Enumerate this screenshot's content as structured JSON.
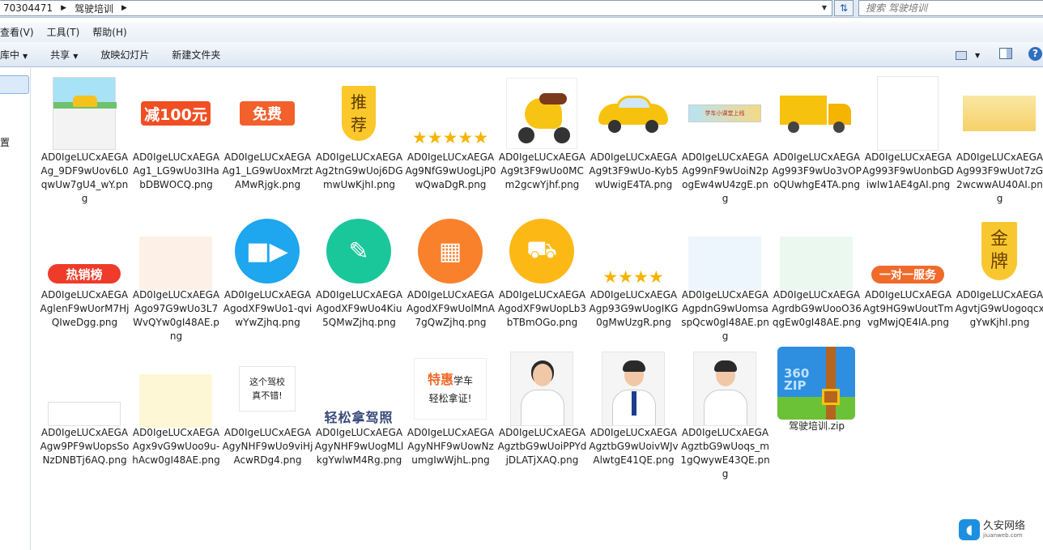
{
  "address": {
    "crumbs": [
      "70304471",
      "驾驶培训"
    ],
    "search_placeholder": "搜索 驾驶培训"
  },
  "menu": [
    "查看(V)",
    "工具(T)",
    "帮助(H)"
  ],
  "toolbar": {
    "items": [
      "库中",
      "共享",
      "放映幻灯片",
      "新建文件夹"
    ]
  },
  "nav": {
    "partial_label": "置"
  },
  "files": [
    "AD0IgeLUCxAEGAAg_9DF9wUov6L0qwUw7gU4_wY.png",
    "AD0IgeLUCxAEGAAg1_LG9wUo3IHabDBWOCQ.png",
    "AD0IgeLUCxAEGAAg1_LG9wUoxMrztAMwRjgk.png",
    "AD0IgeLUCxAEGAAg2tnG9wUoj6DGmwUwKjhI.png",
    "AD0IgeLUCxAEGAAg9NfG9wUogLjP0wQwaDgR.png",
    "AD0IgeLUCxAEGAAg9t3F9wUo0MCm2gcwYjhf.png",
    "AD0IgeLUCxAEGAAg9t3F9wUo-Kyb5wUwigE4TA.png",
    "AD0IgeLUCxAEGAAg99nF9wUoiN2pogEw4wU4zgE.png",
    "AD0IgeLUCxAEGAAg993F9wUo3vOPoQUwhgE4TA.png",
    "AD0IgeLUCxAEGAAg993F9wUonbGDiwIw1AE4gAI.png",
    "AD0IgeLUCxAEGAAg993F9wUot7zG2wcwwAU40AI.png",
    "AD0IgeLUCxAEGAAglenF9wUorM7HjQIweDgg.png",
    "AD0IgeLUCxAEGAAgo97G9wUo3L7WvQYw0gI48AE.png",
    "AD0IgeLUCxAEGAAgodXF9wUo1-qviwYwZjhq.png",
    "AD0IgeLUCxAEGAAgodXF9wUo4Kiu5QMwZjhq.png",
    "AD0IgeLUCxAEGAAgodXF9wUolMnA7gQwZjhq.png",
    "AD0IgeLUCxAEGAAgodXF9wUopLb3bTBmOGo.png",
    "AD0IgeLUCxAEGAAgp93G9wUogIKG0gMwUzgR.png",
    "AD0IgeLUCxAEGAAgpdnG9wUomsaspQcw0gI48AE.png",
    "AD0IgeLUCxAEGAAgrdbG9wUooO36qgEw0gI48AE.png",
    "AD0IgeLUCxAEGAAgt9HG9wUoutTmvgMwjQE4IA.png",
    "AD0IgeLUCxAEGAAgvtjG9wUogoqcxgYwKjhI.png",
    "AD0IgeLUCxAEGAAgw9PF9wUopsSoNzDNBTj6AQ.png",
    "AD0IgeLUCxAEGAAgx9vG9wUoo9u-hAcw0gI48AE.png",
    "AD0IgeLUCxAEGAAgyNHF9wUo9viHjAcwRDg4.png",
    "AD0IgeLUCxAEGAAgyNHF9wUogMLlkgYwlwM4Rg.png",
    "AD0IgeLUCxAEGAAgyNHF9wUowNzumgIwWjhL.png",
    "AD0IgeLUCxAEGAAgztbG9wUoiPPYdjDLATjXAQ.png",
    "AD0IgeLUCxAEGAAgztbG9wUoivWJvAlwtgE41QE.png",
    "AD0IgeLUCxAEGAAgztbG9wUoqs_m1gQwywE43QE.png",
    "驾驶培训.zip"
  ],
  "thumb_text": {
    "discount": "减100元",
    "free": "免费",
    "recommend_1": "推",
    "recommend_2": "荐",
    "hot": "热销榜",
    "one_service": "一对一服务",
    "gold_1": "金",
    "gold_2": "牌",
    "note_1": "这个驾校",
    "note_2": "真不错!",
    "easy": "轻松拿驾照",
    "tehui_1": "特惠",
    "tehui_2": "学车",
    "tehui_3": "轻松拿证!",
    "zip_label_1": "360",
    "zip_label_2": "ZIP",
    "strip": "学车小课堂上线"
  },
  "watermark": {
    "name": "久安网络",
    "url": "jiuanweb.com"
  },
  "colors": {
    "accent": "#2f6fc0",
    "selection": "#dbeafb"
  }
}
